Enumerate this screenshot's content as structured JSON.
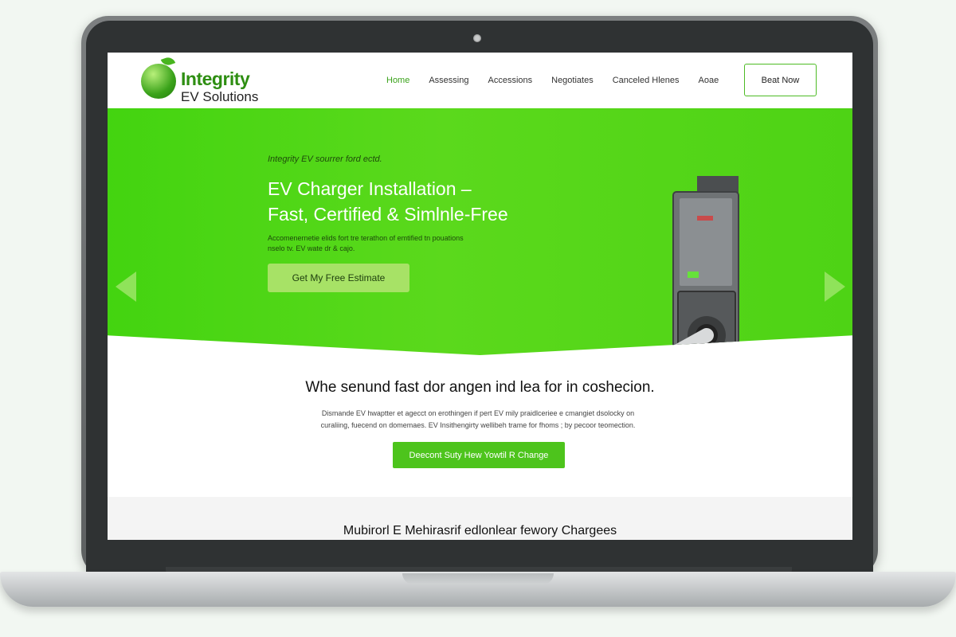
{
  "header": {
    "logo_name": "Integrity",
    "logo_sub": "EV Solutions",
    "nav": [
      {
        "label": "Home",
        "active": true
      },
      {
        "label": "Assessing"
      },
      {
        "label": "Accessions"
      },
      {
        "label": "Negotiates"
      },
      {
        "label": "Canceled Hlenes"
      },
      {
        "label": "Aoae"
      }
    ],
    "cta_label": "Beat Now"
  },
  "hero": {
    "eyebrow": "Integrity EV sourrer ford ectd.",
    "title_line1": "EV Charger Installation –",
    "title_line2": "Fast, Certified & Simlnle-Free",
    "description_line1": "Accomenernetie elids fort tre terathon of emtified tn pouations",
    "description_line2": "nselo tv. EV wate dr & cajo.",
    "cta_label": "Get My Free Estimate",
    "icons": [
      "chevron-left-icon",
      "chevron-right-icon",
      "ev-charger-icon"
    ]
  },
  "section2": {
    "title": "Whe senund fast dor angen ind lea for in coshecion.",
    "description_line1": "Dismande EV hwaptter et agecct on erothingen if pert EV mily praidlceriee e cmangiet dsolocky on",
    "description_line2": "curaliing, fuecend on domemaes. EV Insithengirty wellibeh trame for fhoms ; by pecoor teomection.",
    "cta_label": "Deecont Suty Hew Yowtil R Change"
  },
  "section3": {
    "title": "Mubirorl E Mehirasrif edlonlear fewory Chargees"
  },
  "colors": {
    "brand_green": "#43d410",
    "accent_green": "#4dc41c",
    "hero_cta": "#a7e266"
  }
}
